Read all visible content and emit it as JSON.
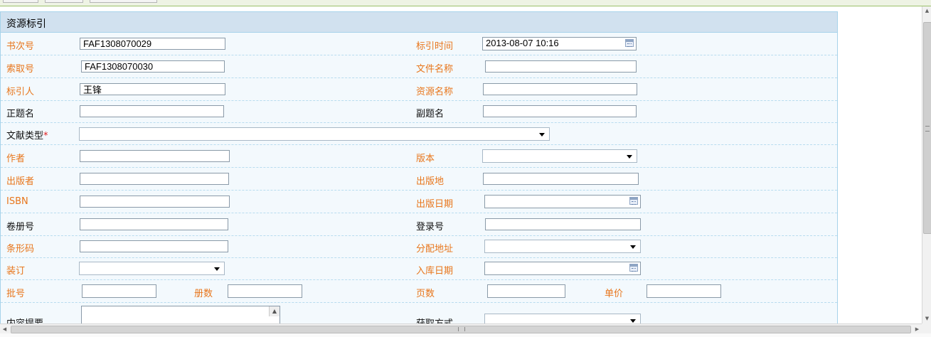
{
  "panel": {
    "title": "资源标引"
  },
  "fields": {
    "book_no": {
      "label": "书次号",
      "value": "FAF1308070029"
    },
    "index_time": {
      "label": "标引时间",
      "value": "2013-08-07 10:16"
    },
    "call_no": {
      "label": "索取号",
      "value": "FAF1308070030"
    },
    "file_name": {
      "label": "文件名称",
      "value": ""
    },
    "indexer": {
      "label": "标引人",
      "value": "王锋"
    },
    "resource_name": {
      "label": "资源名称",
      "value": ""
    },
    "main_title": {
      "label": "正题名",
      "value": ""
    },
    "sub_title": {
      "label": "副题名",
      "value": ""
    },
    "doc_type": {
      "label": "文献类型",
      "required_mark": "*",
      "value": ""
    },
    "author": {
      "label": "作者",
      "value": ""
    },
    "edition": {
      "label": "版本",
      "value": ""
    },
    "publisher": {
      "label": "出版者",
      "value": ""
    },
    "pub_place": {
      "label": "出版地",
      "value": ""
    },
    "isbn": {
      "label": "ISBN",
      "value": ""
    },
    "pub_date": {
      "label": "出版日期",
      "value": ""
    },
    "volume_no": {
      "label": "卷册号",
      "value": ""
    },
    "register_no": {
      "label": "登录号",
      "value": ""
    },
    "barcode": {
      "label": "条形码",
      "value": ""
    },
    "alloc_address": {
      "label": "分配地址",
      "value": ""
    },
    "binding": {
      "label": "装订",
      "value": ""
    },
    "stock_date": {
      "label": "入库日期",
      "value": ""
    },
    "batch_no": {
      "label": "批号",
      "value": ""
    },
    "copies": {
      "label": "册数",
      "value": ""
    },
    "pages": {
      "label": "页数",
      "value": ""
    },
    "unit_price": {
      "label": "单价",
      "value": ""
    },
    "abstract": {
      "label": "内容提要",
      "value": ""
    },
    "acquire_method": {
      "label": "获取方式",
      "value": ""
    }
  },
  "icons": {
    "calendar": "calendar-icon",
    "dropdown": "chevron-down-icon"
  },
  "colors": {
    "label_orange": "#e8761c",
    "header_bg": "#d1e1ef",
    "panel_bg": "#f3f9fd",
    "border": "#a7d3ea"
  }
}
